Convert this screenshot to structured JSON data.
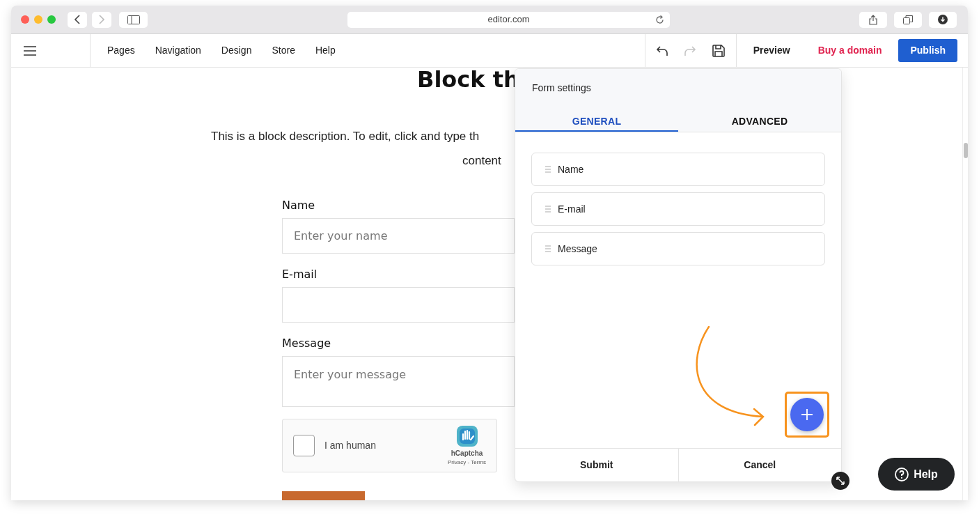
{
  "browser": {
    "url": "editor.com"
  },
  "toolbar": {
    "menu": [
      "Pages",
      "Navigation",
      "Design",
      "Store",
      "Help"
    ],
    "redo_disabled": true,
    "preview": "Preview",
    "buy_domain": "Buy a domain",
    "publish": "Publish"
  },
  "page": {
    "heading": "Block th",
    "description_lines": [
      "This is a block description. To edit, click and type th",
      "content"
    ],
    "fields": [
      {
        "label": "Name",
        "placeholder": "Enter your name",
        "kind": "input"
      },
      {
        "label": "E-mail",
        "kind": "input"
      },
      {
        "label": "Message",
        "placeholder": "Enter your message",
        "kind": "textarea"
      }
    ],
    "captcha": {
      "label": "I am human",
      "checked": false,
      "brand": "hCaptcha",
      "links": "Privacy - Terms"
    }
  },
  "panel": {
    "title": "Form settings",
    "tabs": [
      {
        "label": "GENERAL",
        "selected": true
      },
      {
        "label": "ADVANCED",
        "selected": false
      }
    ],
    "items": [
      "Name",
      "E-mail",
      "Message"
    ],
    "footer": [
      "Submit",
      "Cancel"
    ]
  },
  "help": "Help"
}
